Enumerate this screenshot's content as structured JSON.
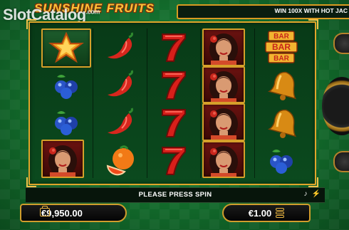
{
  "header": {
    "watermark": "SlotCatalog",
    "watermark_suffix": ".com",
    "game_title": "SUNSHINE FRUITS",
    "ticker": "WIN 100X WITH HOT JAC"
  },
  "reels": [
    [
      "star-icon",
      "blueberry-icon",
      "blueberry-icon",
      "lady-icon"
    ],
    [
      "chili-pepper-icon",
      "chili-pepper-icon",
      "chili-pepper-icon",
      "orange-icon"
    ],
    [
      "seven-icon",
      "seven-icon",
      "seven-icon",
      "seven-icon"
    ],
    [
      "lady-icon",
      "lady-icon",
      "lady-icon",
      "lady-icon"
    ],
    [
      "bar-icon",
      "bell-icon",
      "bell-icon",
      "blueberry-icon"
    ]
  ],
  "bar_symbol": {
    "line1": "BAR",
    "line2": "BAR",
    "line3": "BAR"
  },
  "message": "PLEASE PRESS SPIN",
  "icons": {
    "sound": "music-note-icon",
    "turbo": "lightning-icon"
  },
  "balance": {
    "icon": "wallet-icon",
    "value": "€9,950.00"
  },
  "bet": {
    "icon": "coin-stack-icon",
    "value": "€1.00"
  },
  "colors": {
    "gold": "#e0a52a",
    "felt": "#126a2b",
    "red": "#c8261c"
  }
}
